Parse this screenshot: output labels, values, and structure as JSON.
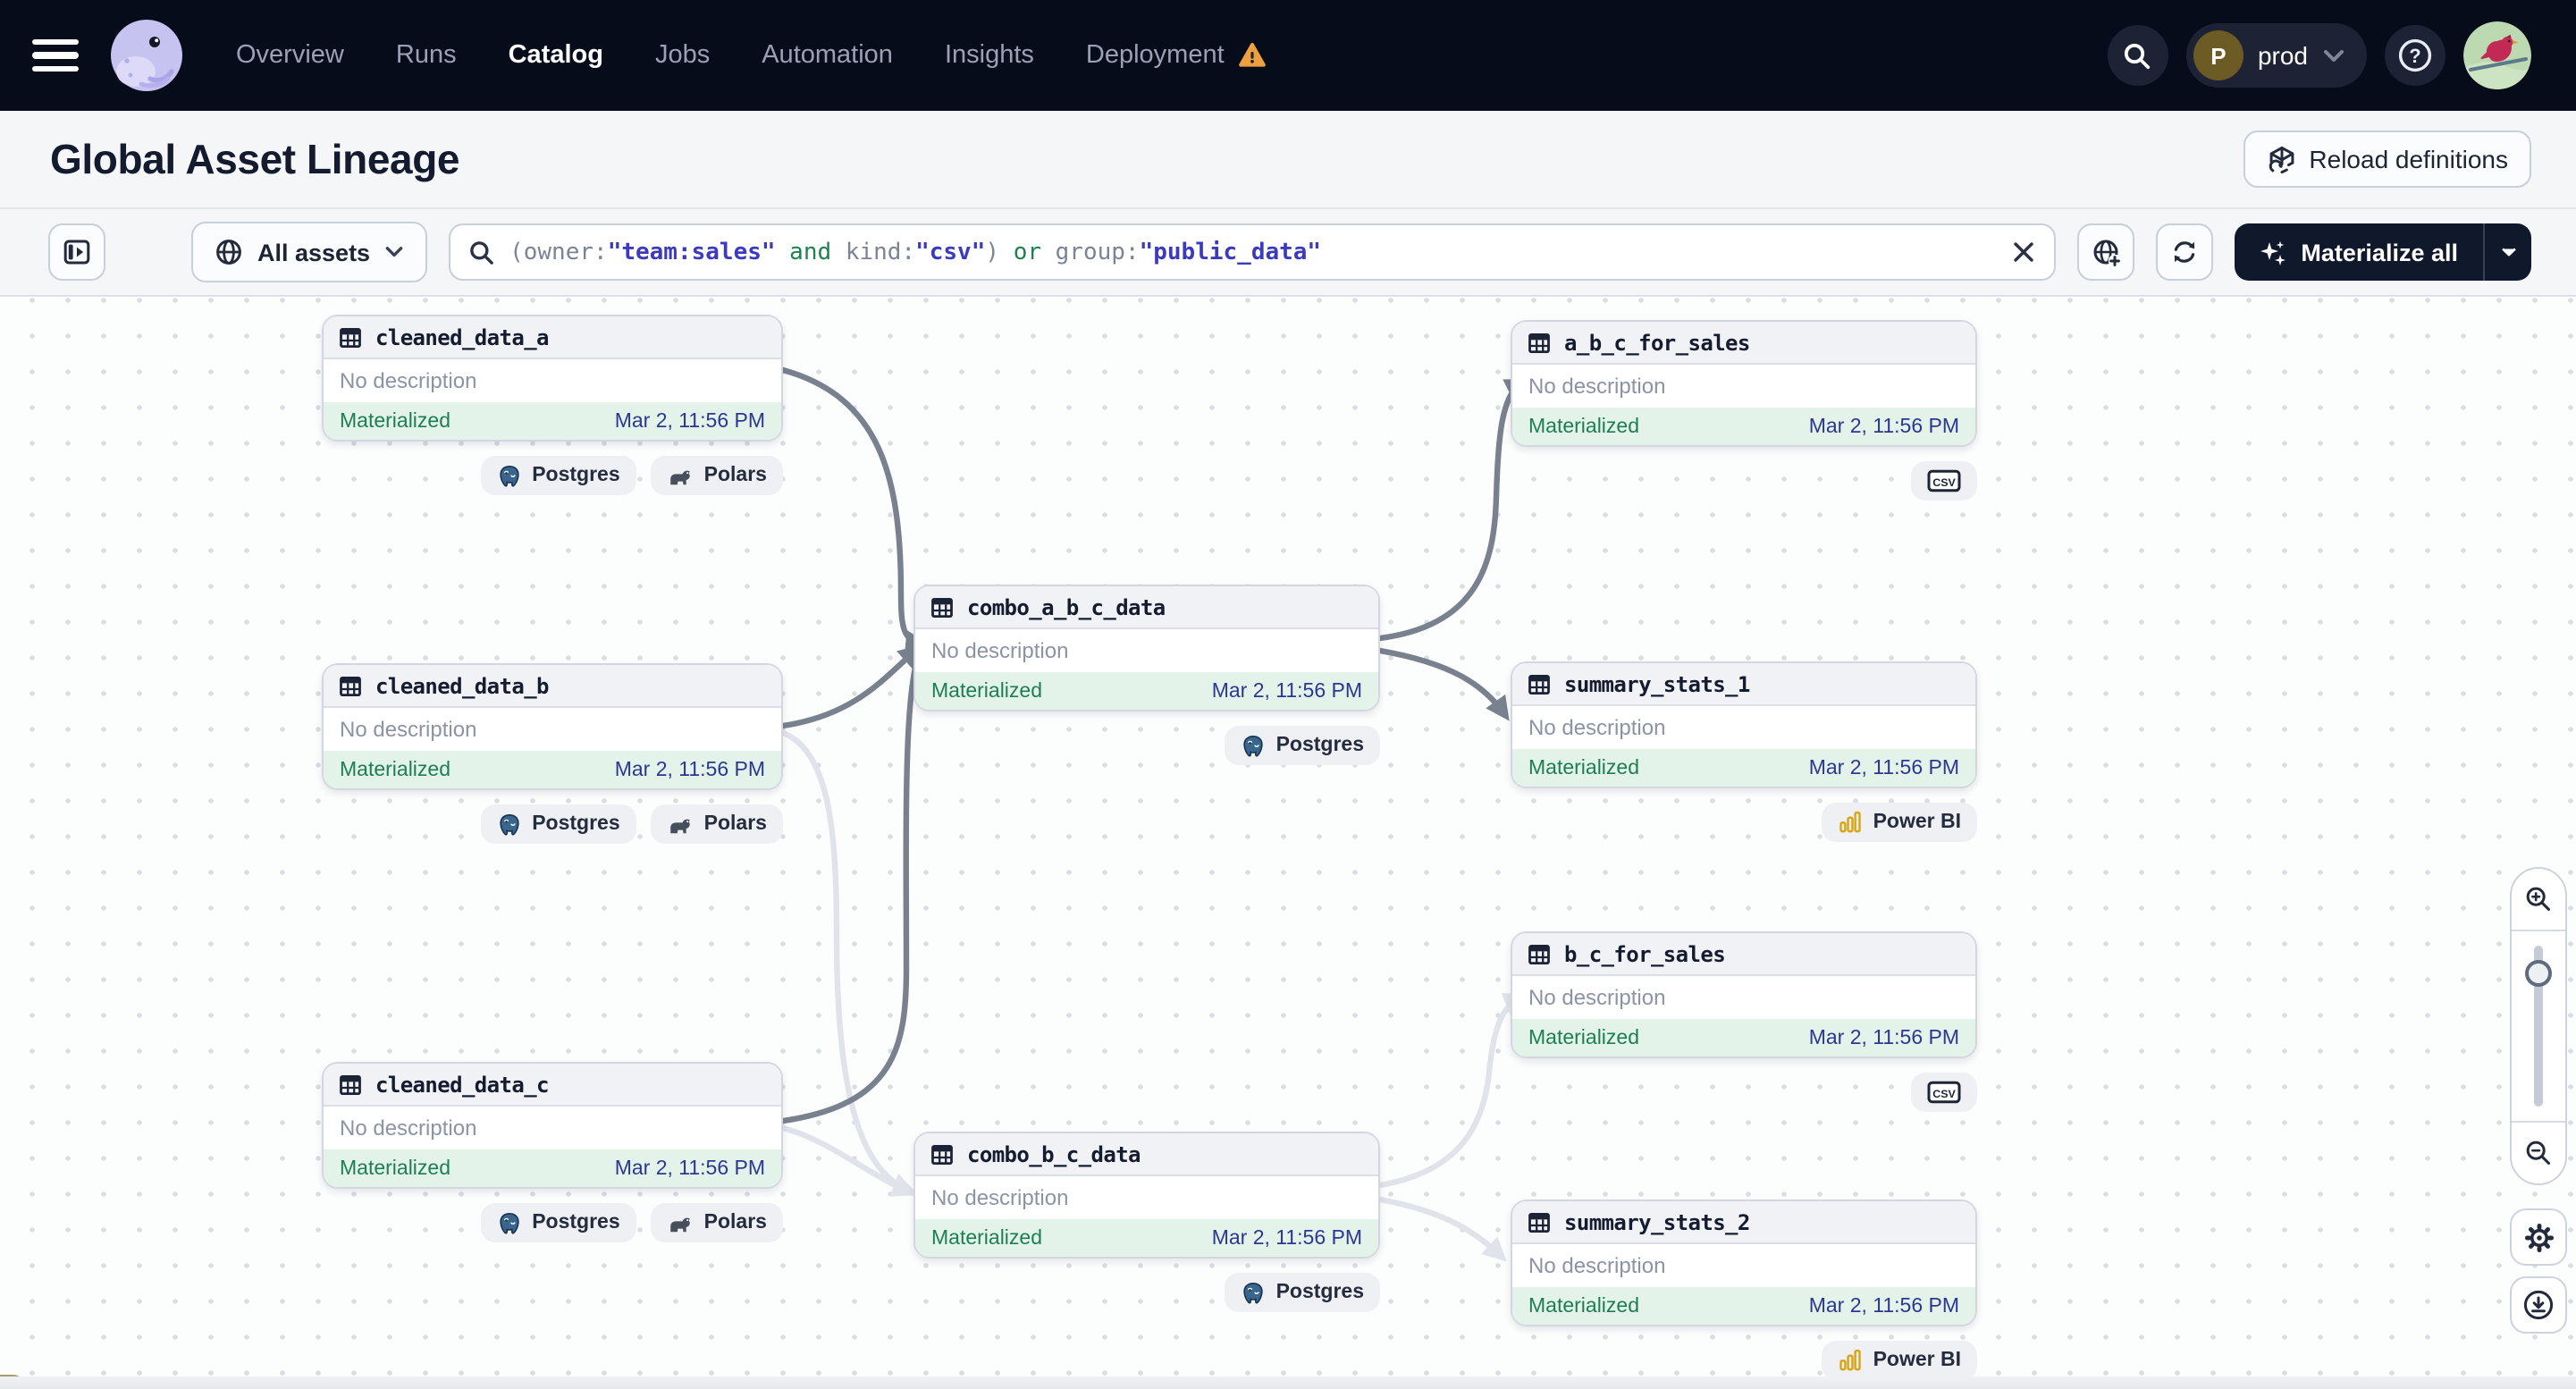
{
  "nav": {
    "items": [
      {
        "label": "Overview",
        "active": false,
        "warning": false
      },
      {
        "label": "Runs",
        "active": false,
        "warning": false
      },
      {
        "label": "Catalog",
        "active": true,
        "warning": false
      },
      {
        "label": "Jobs",
        "active": false,
        "warning": false
      },
      {
        "label": "Automation",
        "active": false,
        "warning": false
      },
      {
        "label": "Insights",
        "active": false,
        "warning": false
      },
      {
        "label": "Deployment",
        "active": false,
        "warning": true
      }
    ],
    "deployment_switcher": {
      "initial": "P",
      "name": "prod"
    },
    "colors": {
      "bar_bg": "#070c1b",
      "warning": "#eda03f",
      "active_text": "#ffffff",
      "text": "#9aa1b5"
    }
  },
  "header": {
    "title": "Global Asset Lineage",
    "reload_button": "Reload definitions"
  },
  "toolbar": {
    "scope_label": "All assets",
    "query_segments": [
      {
        "text": "(owner:",
        "kind": "plain"
      },
      {
        "text": "\"team:sales\"",
        "kind": "string"
      },
      {
        "text": " and ",
        "kind": "keyword"
      },
      {
        "text": "kind:",
        "kind": "plain"
      },
      {
        "text": "\"csv\"",
        "kind": "string"
      },
      {
        "text": ") ",
        "kind": "plain"
      },
      {
        "text": "or ",
        "kind": "keyword"
      },
      {
        "text": "group:",
        "kind": "plain"
      },
      {
        "text": "\"public_data\"",
        "kind": "string"
      }
    ],
    "materialize_label": "Materialize all",
    "query_colors": {
      "plain": "#7b8496",
      "string": "#3d3bbd",
      "keyword": "#1d8150"
    }
  },
  "graph": {
    "tag_labels": {
      "postgres": "Postgres",
      "polars": "Polars",
      "power_bi": "Power BI",
      "csv": "CSV"
    },
    "status_colors": {
      "materialized_bg": "#e3f3e9",
      "materialized_text": "#1e7e53",
      "timestamp_text": "#2d3792"
    },
    "nodes": [
      {
        "id": "cleaned_data_a",
        "name": "cleaned_data_a",
        "description": "No description",
        "status": "Materialized",
        "timestamp": "Mar 2, 11:56 PM",
        "tags": [
          "postgres",
          "polars"
        ]
      },
      {
        "id": "cleaned_data_b",
        "name": "cleaned_data_b",
        "description": "No description",
        "status": "Materialized",
        "timestamp": "Mar 2, 11:56 PM",
        "tags": [
          "postgres",
          "polars"
        ]
      },
      {
        "id": "cleaned_data_c",
        "name": "cleaned_data_c",
        "description": "No description",
        "status": "Materialized",
        "timestamp": "Mar 2, 11:56 PM",
        "tags": [
          "postgres",
          "polars"
        ]
      },
      {
        "id": "combo_a_b_c_data",
        "name": "combo_a_b_c_data",
        "description": "No description",
        "status": "Materialized",
        "timestamp": "Mar 2, 11:56 PM",
        "tags": [
          "postgres"
        ]
      },
      {
        "id": "combo_b_c_data",
        "name": "combo_b_c_data",
        "description": "No description",
        "status": "Materialized",
        "timestamp": "Mar 2, 11:56 PM",
        "tags": [
          "postgres"
        ]
      },
      {
        "id": "a_b_c_for_sales",
        "name": "a_b_c_for_sales",
        "description": "No description",
        "status": "Materialized",
        "timestamp": "Mar 2, 11:56 PM",
        "tags": [
          "csv"
        ]
      },
      {
        "id": "summary_stats_1",
        "name": "summary_stats_1",
        "description": "No description",
        "status": "Materialized",
        "timestamp": "Mar 2, 11:56 PM",
        "tags": [
          "power_bi"
        ]
      },
      {
        "id": "b_c_for_sales",
        "name": "b_c_for_sales",
        "description": "No description",
        "status": "Materialized",
        "timestamp": "Mar 2, 11:56 PM",
        "tags": [
          "csv"
        ]
      },
      {
        "id": "summary_stats_2",
        "name": "summary_stats_2",
        "description": "No description",
        "status": "Materialized",
        "timestamp": "Mar 2, 11:56 PM",
        "tags": [
          "power_bi"
        ]
      }
    ],
    "edges": [
      {
        "from": "cleaned_data_b",
        "to": "combo_b_c_data",
        "emphasis": "soft"
      },
      {
        "from": "cleaned_data_c",
        "to": "combo_b_c_data",
        "emphasis": "soft"
      },
      {
        "from": "combo_b_c_data",
        "to": "b_c_for_sales",
        "emphasis": "soft"
      },
      {
        "from": "combo_b_c_data",
        "to": "summary_stats_2",
        "emphasis": "soft"
      },
      {
        "from": "cleaned_data_a",
        "to": "combo_a_b_c_data",
        "emphasis": "strong"
      },
      {
        "from": "cleaned_data_b",
        "to": "combo_a_b_c_data",
        "emphasis": "strong"
      },
      {
        "from": "cleaned_data_c",
        "to": "combo_a_b_c_data",
        "emphasis": "strong"
      },
      {
        "from": "combo_a_b_c_data",
        "to": "a_b_c_for_sales",
        "emphasis": "strong"
      },
      {
        "from": "combo_a_b_c_data",
        "to": "summary_stats_1",
        "emphasis": "strong"
      }
    ],
    "edge_colors": {
      "strong": "#79818f",
      "soft": "#e0e3e9"
    }
  }
}
